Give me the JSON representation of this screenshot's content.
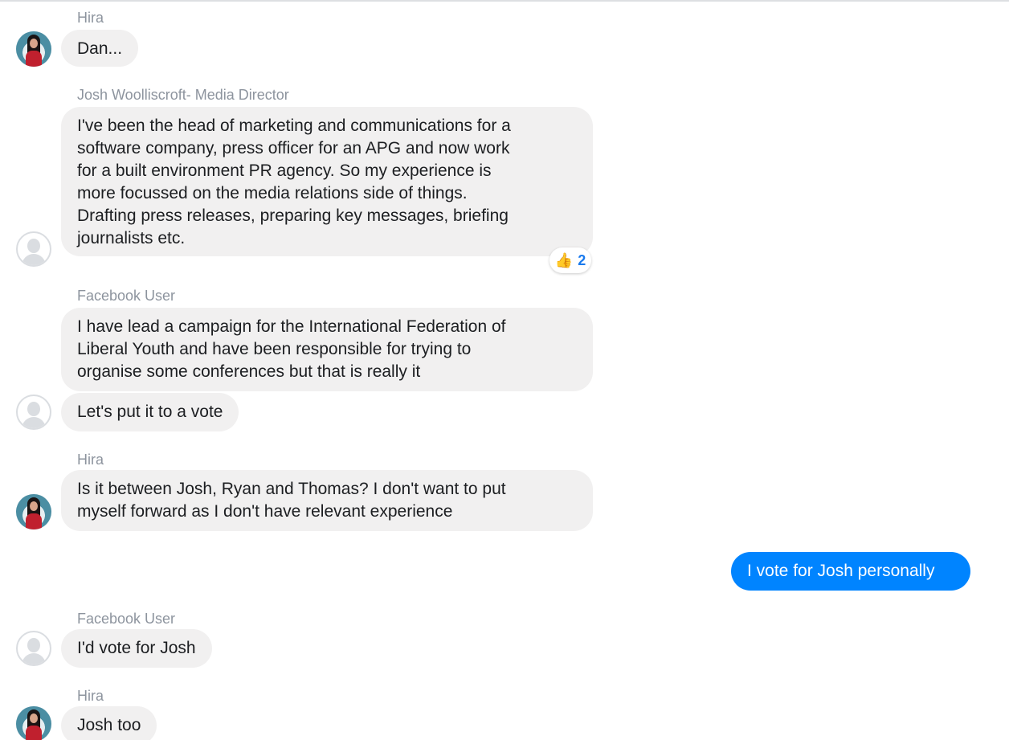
{
  "messages": [
    {
      "sender": "Hira",
      "lines": [
        "Dan..."
      ]
    },
    {
      "sender": "Josh Woolliscroft- Media Director",
      "lines": [
        "I've been the head of marketing and communications for a",
        "software company, press officer for an APG and now work",
        "for a built environment PR agency. So my experience is",
        "more focussed on the media relations side of things.",
        "Drafting press releases, preparing key messages, briefing",
        "journalists etc."
      ],
      "reaction": {
        "icon": "thumbs-up",
        "count": "2"
      }
    },
    {
      "sender": "Facebook User",
      "lines": [
        "I have lead a campaign for the International Federation of",
        "Liberal Youth and have been responsible for trying to",
        "organise some conferences but that is really it"
      ]
    },
    {
      "sender": "",
      "lines": [
        "Let's put it to a vote"
      ]
    },
    {
      "sender": "Hira",
      "lines": [
        "Is it between Josh, Ryan and Thomas? I don't want to put",
        "myself forward as I don't have relevant experience"
      ]
    },
    {
      "sender": "",
      "lines": [
        "I vote for Josh personally"
      ],
      "outgoing": true
    },
    {
      "sender": "Facebook User",
      "lines": [
        "I'd vote for Josh"
      ]
    },
    {
      "sender": "Hira",
      "lines": [
        "Josh too"
      ]
    }
  ],
  "colors": {
    "incoming_bubble": "#f1f0f0",
    "outgoing_bubble": "#0084ff",
    "sender_text": "#8d949e",
    "reaction_count": "#1a7aed"
  }
}
